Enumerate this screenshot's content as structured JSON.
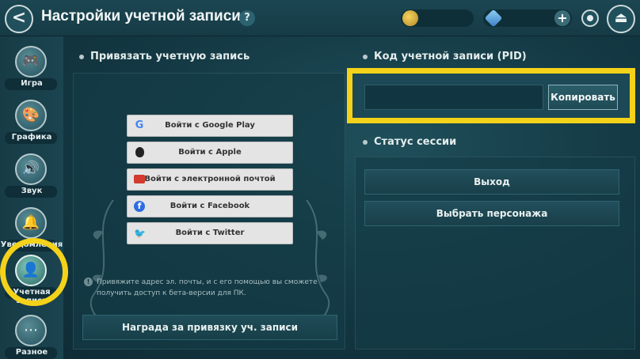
{
  "header": {
    "back_label": "<",
    "title": "Настройки учетной записи",
    "help_label": "?",
    "plus_label": "+",
    "exit_label": "⏏"
  },
  "sidebar": {
    "items": [
      {
        "label": "Игра",
        "icon": "gamepad-icon",
        "glyph": "🎮"
      },
      {
        "label": "Графика",
        "icon": "palette-icon",
        "glyph": "🎨"
      },
      {
        "label": "Звук",
        "icon": "speaker-icon",
        "glyph": "🔊"
      },
      {
        "label": "Уведомления",
        "icon": "bell-icon",
        "glyph": "🔔"
      },
      {
        "label": "Учетная запись",
        "icon": "account-icon",
        "glyph": "👤"
      },
      {
        "label": "Разное",
        "icon": "more-icon",
        "glyph": "⋯"
      }
    ],
    "active_index": 4
  },
  "link_account": {
    "title": "Привязать учетную запись",
    "buttons": [
      {
        "label": "Войти с Google Play",
        "icon": "google-icon",
        "glyph": "G"
      },
      {
        "label": "Войти с Apple",
        "icon": "apple-icon",
        "glyph": ""
      },
      {
        "label": "Войти с электронной почтой",
        "icon": "mail-icon",
        "glyph": ""
      },
      {
        "label": "Войти с Facebook",
        "icon": "facebook-icon",
        "glyph": "f"
      },
      {
        "label": "Войти с Twitter",
        "icon": "twitter-icon",
        "glyph": "🐦"
      }
    ],
    "info": "Привяжите адрес эл. почты, и с его помощью вы сможете получить доступ к бета-версии для ПК.",
    "info_icon": "!",
    "reward_button": "Награда за привязку уч. записи"
  },
  "pid": {
    "title": "Код учетной записи (PID)",
    "value": "",
    "copy_label": "Копировать"
  },
  "session": {
    "title": "Статус сессии",
    "logout_label": "Выход",
    "choose_character_label": "Выбрать персонажа"
  },
  "colors": {
    "highlight": "#f4d21a",
    "background": "#143a45"
  }
}
